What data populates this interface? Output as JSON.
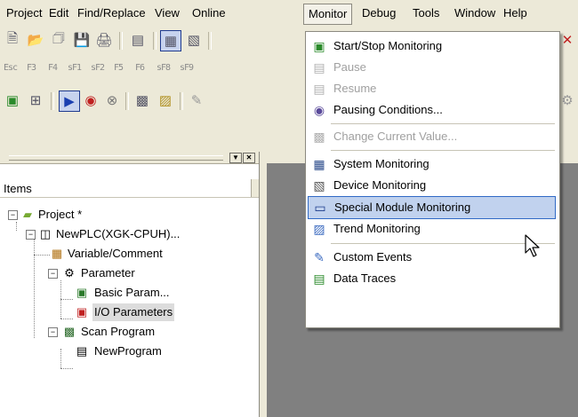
{
  "menubar": {
    "items": [
      "Project",
      "Edit",
      "Find/Replace",
      "View",
      "Online",
      "Monitor",
      "Debug",
      "Tools",
      "Window",
      "Help"
    ],
    "open_item": "Monitor"
  },
  "toolbar_rows": {
    "function_keys": [
      "Esc",
      "F3",
      "F4",
      "sF1",
      "sF2",
      "F5",
      "F6",
      "sF8",
      "sF9"
    ]
  },
  "project_panel": {
    "header": "Items",
    "tree": [
      {
        "label": "Project *",
        "icon": "project-icon"
      },
      {
        "label": "NewPLC(XGK-CPUH)...",
        "icon": "plc-icon"
      },
      {
        "label": "Variable/Comment",
        "icon": "variable-icon"
      },
      {
        "label": "Parameter",
        "icon": "parameter-icon"
      },
      {
        "label": "Basic Param...",
        "icon": "basic-param-icon"
      },
      {
        "label": "I/O Parameters",
        "icon": "io-param-icon"
      },
      {
        "label": "Scan Program",
        "icon": "scan-program-icon"
      },
      {
        "label": "NewProgram",
        "icon": "program-icon"
      }
    ]
  },
  "monitor_menu": {
    "items": [
      {
        "label": "Start/Stop Monitoring",
        "icon": "start-stop-monitoring-icon",
        "enabled": true
      },
      {
        "label": "Pause",
        "icon": "pause-icon",
        "enabled": false
      },
      {
        "label": "Resume",
        "icon": "resume-icon",
        "enabled": false
      },
      {
        "label": "Pausing Conditions...",
        "icon": "pausing-conditions-icon",
        "enabled": true
      },
      {
        "label": "Change Current Value...",
        "icon": "change-value-icon",
        "enabled": false
      },
      {
        "label": "System Monitoring",
        "icon": "system-monitoring-icon",
        "enabled": true
      },
      {
        "label": "Device Monitoring",
        "icon": "device-monitoring-icon",
        "enabled": true
      },
      {
        "label": "Special Module Monitoring",
        "icon": "special-module-icon",
        "enabled": true,
        "highlighted": true
      },
      {
        "label": "Trend Monitoring",
        "icon": "trend-monitoring-icon",
        "enabled": true
      },
      {
        "label": "Custom Events",
        "icon": "custom-events-icon",
        "enabled": true
      },
      {
        "label": "Data Traces",
        "icon": "data-traces-icon",
        "enabled": true
      }
    ]
  },
  "colors": {
    "highlight_bg": "#c1d2ee",
    "highlight_border": "#316ac5",
    "workspace": "#808080",
    "chrome": "#ece9d8"
  }
}
